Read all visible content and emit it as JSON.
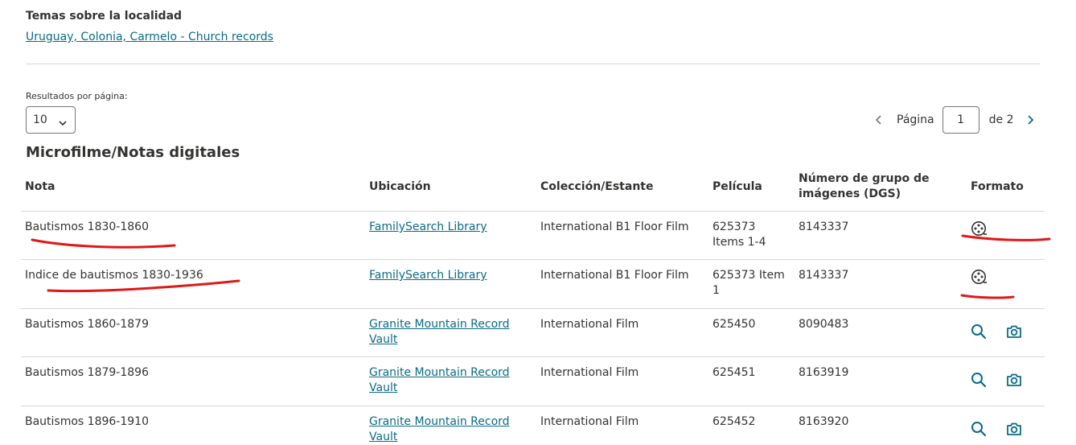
{
  "topics": {
    "heading": "Temas sobre la localidad",
    "link": "Uruguay, Colonia, Carmelo - Church records"
  },
  "results_per_page": {
    "label": "Resultados por página:",
    "value": "10"
  },
  "pagination": {
    "page_label": "Página",
    "current_page": "1",
    "of_label": "de 2"
  },
  "section_title": "Microfilme/Notas digitales",
  "table": {
    "headers": {
      "note": "Nota",
      "location": "Ubicación",
      "collection": "Colección/Estante",
      "film": "Película",
      "dgs": "Número de grupo de imágenes (DGS)",
      "format": "Formato"
    },
    "rows": [
      {
        "note": "Bautismos 1830-1860",
        "location": "FamilySearch Library",
        "collection": "International B1 Floor Film",
        "film": "625373 Items 1-4",
        "dgs": "8143337",
        "format": [
          "film-reel-icon"
        ]
      },
      {
        "note": "Indice de bautismos 1830-1936",
        "location": "FamilySearch Library",
        "collection": "International B1 Floor Film",
        "film": "625373 Item 1",
        "dgs": "8143337",
        "format": [
          "film-reel-icon"
        ]
      },
      {
        "note": "Bautismos 1860-1879",
        "location": "Granite Mountain Record Vault",
        "collection": "International Film",
        "film": "625450",
        "dgs": "8090483",
        "format": [
          "search-icon",
          "camera-icon"
        ]
      },
      {
        "note": "Bautismos 1879-1896",
        "location": "Granite Mountain Record Vault",
        "collection": "International Film",
        "film": "625451",
        "dgs": "8163919",
        "format": [
          "search-icon",
          "camera-icon"
        ]
      },
      {
        "note": "Bautismos 1896-1910",
        "location": "Granite Mountain Record Vault",
        "collection": "International Film",
        "film": "625452",
        "dgs": "8163920",
        "format": [
          "search-icon",
          "camera-icon"
        ]
      }
    ]
  },
  "colors": {
    "link": "#0a6b84",
    "text": "#333331",
    "annotation": "#e01818"
  }
}
